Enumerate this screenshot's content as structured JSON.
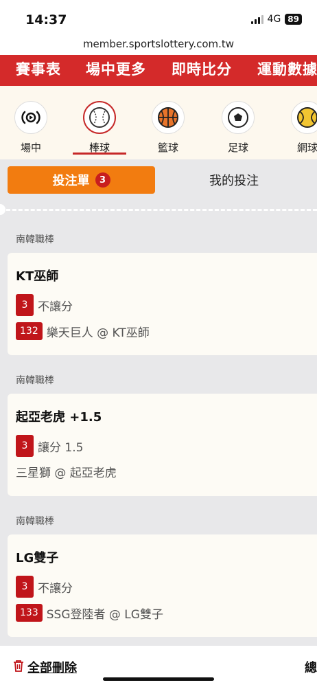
{
  "status": {
    "time": "14:37",
    "network": "4G",
    "battery": "89"
  },
  "url": "member.sportslottery.com.tw",
  "topnav": [
    "賽事表",
    "場中更多",
    "即時比分",
    "運動數據"
  ],
  "sports": [
    {
      "label": "場中",
      "icon": "live-play-icon"
    },
    {
      "label": "棒球",
      "icon": "baseball-icon"
    },
    {
      "label": "籃球",
      "icon": "basketball-icon"
    },
    {
      "label": "足球",
      "icon": "soccer-ball-icon"
    },
    {
      "label": "網球",
      "icon": "tennis-ball-icon"
    }
  ],
  "tabs": {
    "active": "投注單",
    "active_count": "3",
    "other": "我的投注"
  },
  "bets": [
    {
      "league": "南韓職棒",
      "title": "KT巫師",
      "odds": "3",
      "type": "不讓分",
      "code": "132",
      "match": "樂天巨人 @ KT巫師"
    },
    {
      "league": "南韓職棒",
      "title": "起亞老虎 +1.5",
      "odds": "3",
      "type": "讓分 1.5",
      "code": "",
      "match": "三星獅 @ 起亞老虎"
    },
    {
      "league": "南韓職棒",
      "title": "LG雙子",
      "odds": "3",
      "type": "不讓分",
      "code": "133",
      "match": "SSG登陸者 @ LG雙子"
    }
  ],
  "footer": {
    "delete_all": "全部刪除",
    "total": "總"
  },
  "colors": {
    "brand_red": "#d42a2a",
    "tab_orange": "#f27c10",
    "pill_red": "#c0151a"
  }
}
